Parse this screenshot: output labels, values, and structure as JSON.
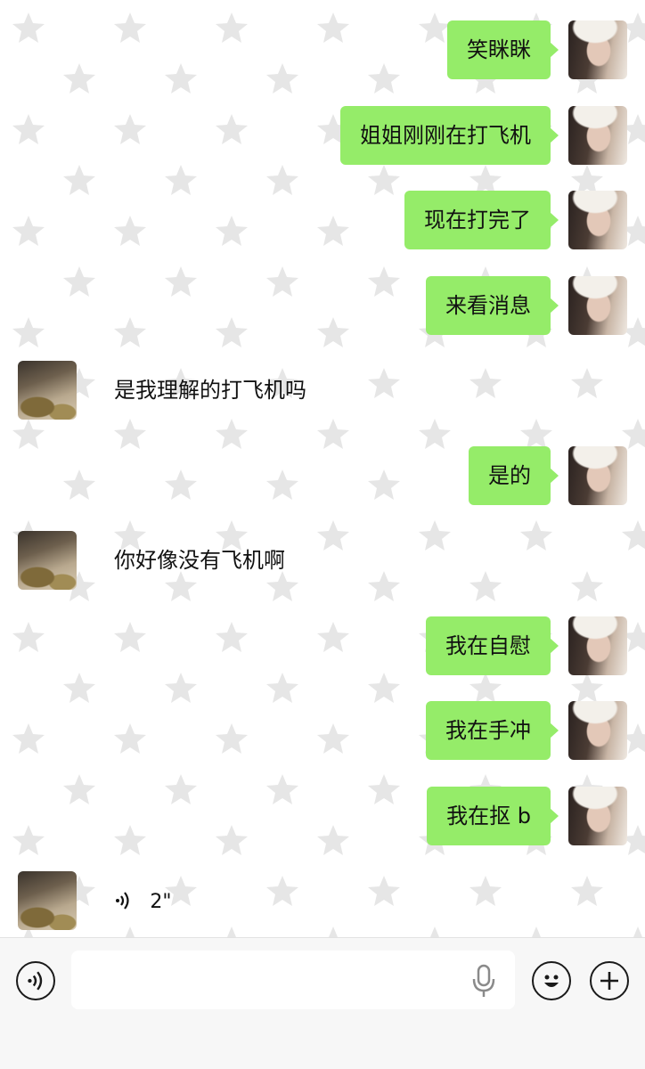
{
  "messages": [
    {
      "side": "me",
      "type": "text",
      "text": "笑眯眯"
    },
    {
      "side": "me",
      "type": "text",
      "text": "姐姐刚刚在打飞机"
    },
    {
      "side": "me",
      "type": "text",
      "text": "现在打完了"
    },
    {
      "side": "me",
      "type": "text",
      "text": "来看消息"
    },
    {
      "side": "other",
      "type": "text",
      "text": "是我理解的打飞机吗"
    },
    {
      "side": "me",
      "type": "text",
      "text": "是的"
    },
    {
      "side": "other",
      "type": "text",
      "text": "你好像没有飞机啊"
    },
    {
      "side": "me",
      "type": "text",
      "text": "我在自慰"
    },
    {
      "side": "me",
      "type": "text",
      "text": "我在手冲"
    },
    {
      "side": "me",
      "type": "text",
      "text": "我在抠 b"
    },
    {
      "side": "other",
      "type": "voice",
      "duration": "2\""
    }
  ],
  "input_bar": {
    "voice_toggle_icon": "voice-wave-icon",
    "placeholder": "",
    "mic_icon": "microphone-icon",
    "emoji_icon": "smiley-icon",
    "plus_icon": "plus-icon"
  },
  "colors": {
    "my_bubble": "#95ec69",
    "input_bar_bg": "#f7f7f7"
  }
}
